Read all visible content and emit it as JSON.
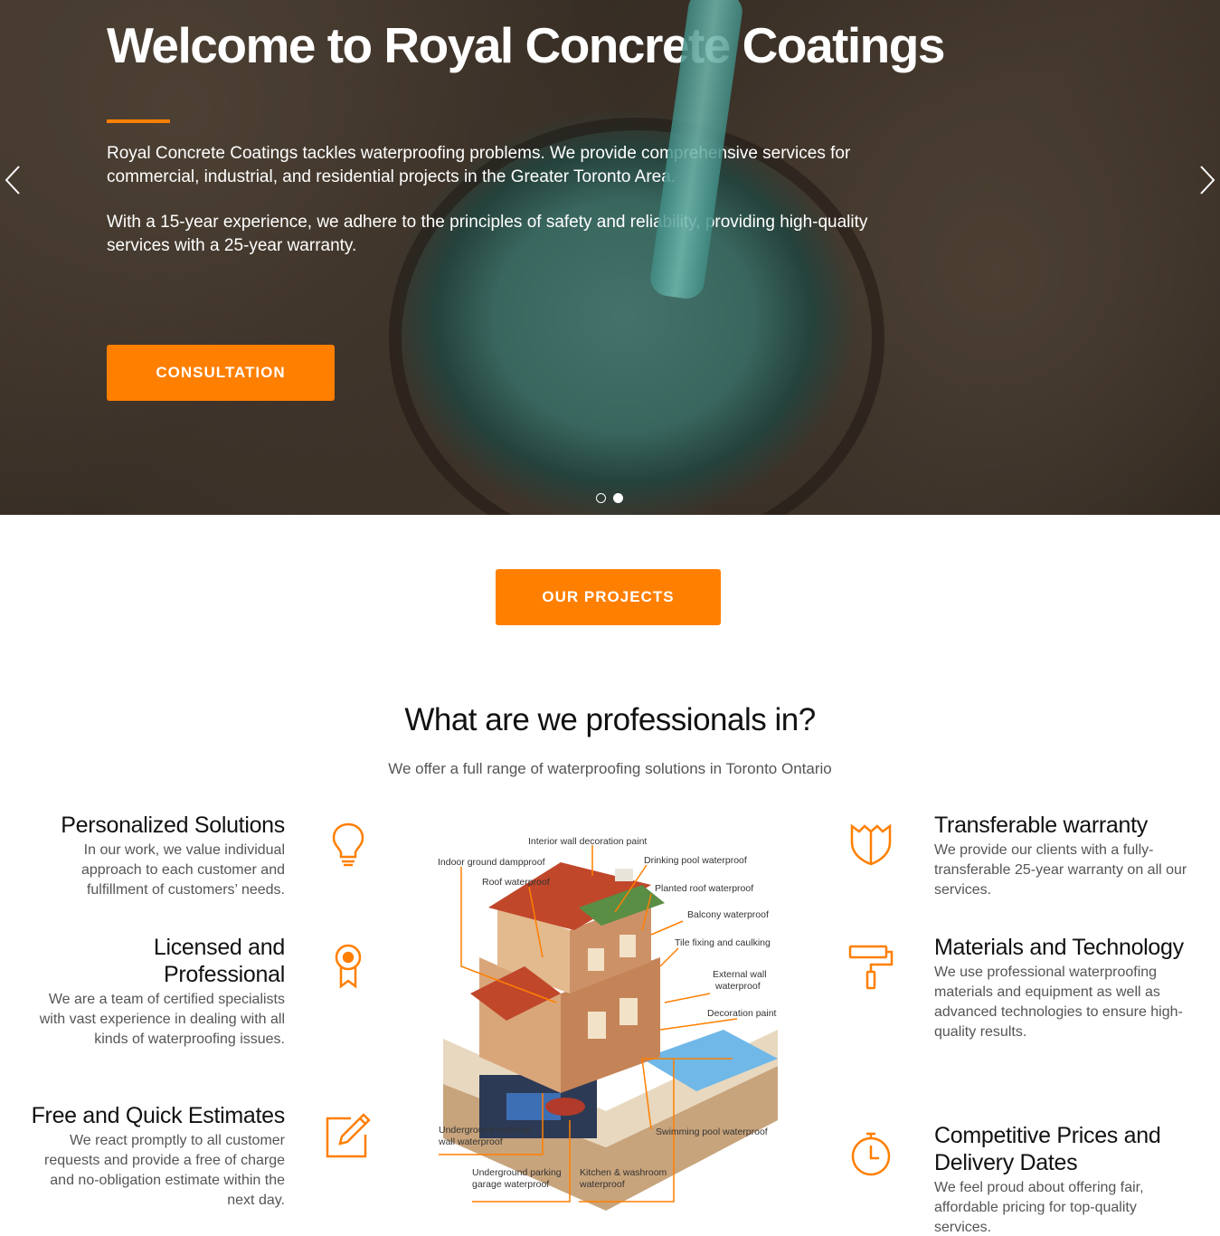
{
  "hero": {
    "title": "Welcome to Royal Concrete Coatings",
    "paragraph1": "Royal Concrete Coatings tackles waterproofing problems. We provide comprehensive services for commercial, industrial, and residential projects in the Greater Toronto Area.",
    "paragraph2": "With a 15-year experience, we adhere to the principles of safety and reliability, providing high-quality services with a 25-year warranty.",
    "cta_label": "CONSULTATION",
    "slides": [
      {
        "active": false
      },
      {
        "active": true
      }
    ]
  },
  "projects_button": "OUR PROJECTS",
  "services": {
    "title": "What are we professionals in?",
    "subtitle": "We offer a full range of waterproofing solutions in Toronto Ontario",
    "left": [
      {
        "title": "Personalized Solutions",
        "text": "In our work, we value individual approach to each customer and fulfillment of customers’ needs.",
        "icon": "lightbulb-icon"
      },
      {
        "title": "Licensed and Professional",
        "text": "We are a team of certified specialists with vast experience in dealing with all kinds of waterproofing issues.",
        "icon": "award-ribbon-icon"
      },
      {
        "title": "Free and Quick Estimates",
        "text": "We react promptly to all customer requests and provide a free of charge and no-obligation estimate within the next day.",
        "icon": "edit-pencil-icon"
      }
    ],
    "right": [
      {
        "title": "Transferable warranty",
        "text": "We provide our clients with a fully-transferable 25-year warranty on all our services.",
        "icon": "shield-icon"
      },
      {
        "title": "Materials and Technology",
        "text": "We use professional waterproofing materials and equipment as well as advanced technologies to ensure high-quality results.",
        "icon": "paint-roller-icon"
      },
      {
        "title": "Competitive Prices and Delivery Dates",
        "text": "We feel proud about offering fair, affordable pricing for top-quality services.",
        "icon": "stopwatch-icon"
      }
    ],
    "diagram_labels": {
      "interior_wall": "Interior wall decoration paint",
      "indoor_ground": "Indoor ground dampproof",
      "drinking_pool": "Drinking pool waterproof",
      "roof": "Roof waterproof",
      "planted_roof": "Planted roof waterproof",
      "balcony": "Balcony waterproof",
      "tile_fixing": "Tile fixing and caulking",
      "external_wall_1": "External wall",
      "external_wall_2": "waterproof",
      "decoration_paint": "Decoration paint",
      "underground_external_1": "Underground external",
      "underground_external_2": "wall waterproof",
      "swimming_pool": "Swimming pool waterproof",
      "parking_1": "Underground parking",
      "parking_2": "garage waterproof",
      "kitchen_1": "Kitchen & washroom",
      "kitchen_2": "waterproof"
    }
  },
  "colors": {
    "accent": "#ff7f00",
    "heading": "#111111",
    "body_text": "#555555"
  }
}
